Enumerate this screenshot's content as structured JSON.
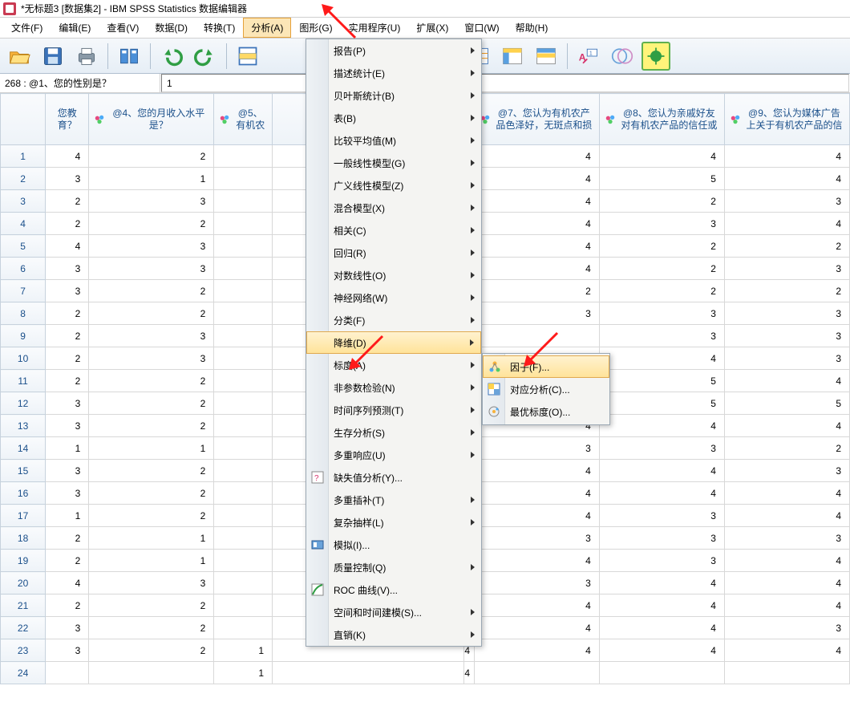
{
  "title": "*无标题3 [数据集2] - IBM SPSS Statistics 数据编辑器",
  "menubar": {
    "file": "文件(F)",
    "edit": "编辑(E)",
    "view": "查看(V)",
    "data": "数据(D)",
    "transform": "转换(T)",
    "analyze": "分析(A)",
    "graphs": "图形(G)",
    "utilities": "实用程序(U)",
    "extensions": "扩展(X)",
    "window": "窗口(W)",
    "help": "帮助(H)"
  },
  "cellref": {
    "name": "268 : @1、您的性别是？",
    "value": "1"
  },
  "columns": {
    "c3_frag": "您教育？",
    "c4": "@4、您的月收入水平是？",
    "c5_frag": "@5、有机农",
    "c7": "@7、您认为有机农产品色泽好，无斑点和损",
    "c8": "@8、您认为亲戚好友对有机农产品的信任或",
    "c9": "@9、您认为媒体广告上关于有机农产品的信"
  },
  "rows": [
    {
      "n": 1,
      "c3": 4,
      "c4": 2,
      "c7": 4,
      "c8": 4,
      "c9": 4
    },
    {
      "n": 2,
      "c3": 3,
      "c4": 1,
      "c7": 4,
      "c8": 5,
      "c9": 4
    },
    {
      "n": 3,
      "c3": 2,
      "c4": 3,
      "c7": 4,
      "c8": 2,
      "c9": 3
    },
    {
      "n": 4,
      "c3": 2,
      "c4": 2,
      "c7": 4,
      "c8": 3,
      "c9": 4
    },
    {
      "n": 5,
      "c3": 4,
      "c4": 3,
      "c7": 4,
      "c8": 2,
      "c9": 2
    },
    {
      "n": 6,
      "c3": 3,
      "c4": 3,
      "c7": 4,
      "c8": 2,
      "c9": 3
    },
    {
      "n": 7,
      "c3": 3,
      "c4": 2,
      "c7": 2,
      "c8": 2,
      "c9": 2
    },
    {
      "n": 8,
      "c3": 2,
      "c4": 2,
      "c7": 3,
      "c8": 3,
      "c9": 3
    },
    {
      "n": 9,
      "c3": 2,
      "c4": 3,
      "c7v": "",
      "c8": 3,
      "c9": 3
    },
    {
      "n": 10,
      "c3": 2,
      "c4": 3,
      "c7v": "",
      "c8": 4,
      "c9": 3
    },
    {
      "n": 11,
      "c3": 2,
      "c4": 2,
      "c7v": "",
      "c8": 5,
      "c9": 4
    },
    {
      "n": 12,
      "c3": 3,
      "c4": 2,
      "c7p": "ɔ",
      "c8": 5,
      "c9": 5
    },
    {
      "n": 13,
      "c3": 3,
      "c4": 2,
      "c7": 4,
      "c8": 4,
      "c9": 4
    },
    {
      "n": 14,
      "c3": 1,
      "c4": 1,
      "c7": 3,
      "c8": 3,
      "c9": 2
    },
    {
      "n": 15,
      "c3": 3,
      "c4": 2,
      "c7": 4,
      "c8": 4,
      "c9": 3
    },
    {
      "n": 16,
      "c3": 3,
      "c4": 2,
      "c7": 4,
      "c8": 4,
      "c9": 4
    },
    {
      "n": 17,
      "c3": 1,
      "c4": 2,
      "c7": 4,
      "c8": 3,
      "c9": 4
    },
    {
      "n": 18,
      "c3": 2,
      "c4": 1,
      "c7": 3,
      "c8": 3,
      "c9": 3
    },
    {
      "n": 19,
      "c3": 2,
      "c4": 1,
      "c7": 4,
      "c8": 3,
      "c9": 4
    },
    {
      "n": 20,
      "c3": 4,
      "c4": 3,
      "c7": 3,
      "c8": 4,
      "c9": 4
    },
    {
      "n": 21,
      "c3": 2,
      "c4": 2,
      "c7": 4,
      "c8": 4,
      "c9": 4
    },
    {
      "n": 22,
      "c3": 3,
      "c4": 2,
      "c7": 4,
      "c8": 4,
      "c9": 3
    },
    {
      "n": 23,
      "c3": 3,
      "c4": 2,
      "c5": 1,
      "c6": 4,
      "c7": 4,
      "c8": 4,
      "c9": 4
    },
    {
      "n": 24,
      "c3": "",
      "c4": "",
      "c5": 1,
      "c6": 4,
      "c7": "",
      "c8": "",
      "c9": ""
    }
  ],
  "analyze_menu": [
    {
      "label": "报告(P)",
      "arrow": true
    },
    {
      "label": "描述统计(E)",
      "arrow": true
    },
    {
      "label": "贝叶斯统计(B)",
      "arrow": true
    },
    {
      "label": "表(B)",
      "arrow": true
    },
    {
      "label": "比较平均值(M)",
      "arrow": true
    },
    {
      "label": "一般线性模型(G)",
      "arrow": true
    },
    {
      "label": "广义线性模型(Z)",
      "arrow": true
    },
    {
      "label": "混合模型(X)",
      "arrow": true
    },
    {
      "label": "相关(C)",
      "arrow": true
    },
    {
      "label": "回归(R)",
      "arrow": true
    },
    {
      "label": "对数线性(O)",
      "arrow": true
    },
    {
      "label": "神经网络(W)",
      "arrow": true
    },
    {
      "label": "分类(F)",
      "arrow": true
    },
    {
      "label": "降维(D)",
      "arrow": true,
      "hover": true
    },
    {
      "label": "标度(A)",
      "arrow": true
    },
    {
      "label": "非参数检验(N)",
      "arrow": true
    },
    {
      "label": "时间序列预测(T)",
      "arrow": true
    },
    {
      "label": "生存分析(S)",
      "arrow": true
    },
    {
      "label": "多重响应(U)",
      "arrow": true
    },
    {
      "label": "缺失值分析(Y)...",
      "icon": "missing"
    },
    {
      "label": "多重插补(T)",
      "arrow": true
    },
    {
      "label": "复杂抽样(L)",
      "arrow": true
    },
    {
      "label": "模拟(I)...",
      "icon": "sim"
    },
    {
      "label": "质量控制(Q)",
      "arrow": true
    },
    {
      "label": "ROC 曲线(V)...",
      "icon": "roc"
    },
    {
      "label": "空间和时间建模(S)...",
      "arrow": true
    },
    {
      "label": "直销(K)",
      "arrow": true
    }
  ],
  "dimred_submenu": [
    {
      "label": "因子(F)...",
      "icon": "factor",
      "hover": true
    },
    {
      "label": "对应分析(C)...",
      "icon": "corr"
    },
    {
      "label": "最优标度(O)...",
      "icon": "scale"
    }
  ]
}
